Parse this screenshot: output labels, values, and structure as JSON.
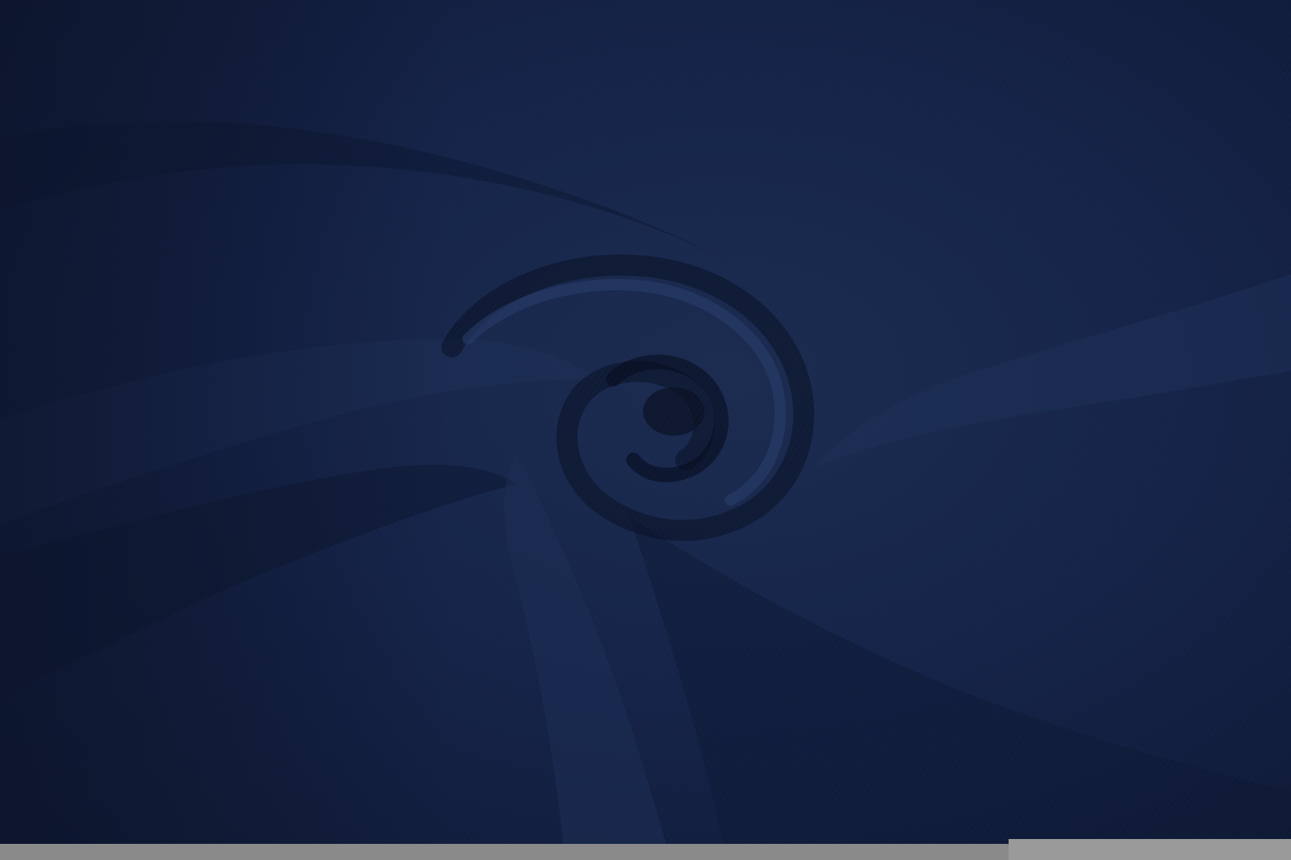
{
  "image": {
    "subject": "navy-fabric-swirl",
    "colors": {
      "fabric_base": "#14203d",
      "fabric_shadow": "#0b1226",
      "fabric_highlight": "#24365f",
      "bottom_band": "#8a8a8a"
    }
  }
}
